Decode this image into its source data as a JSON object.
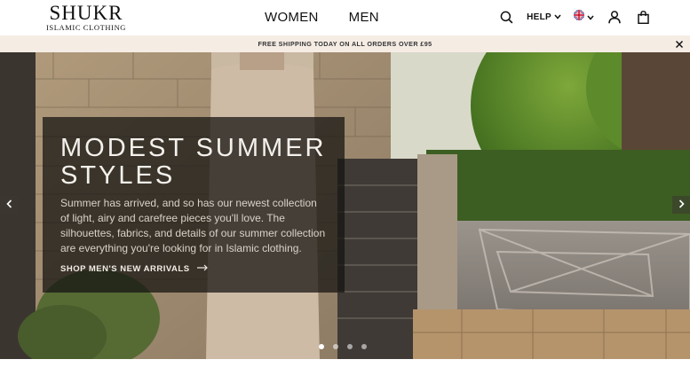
{
  "brand": {
    "name": "SHUKR",
    "tagline": "ISLAMIC CLOTHING"
  },
  "nav": {
    "women": "WOMEN",
    "men": "MEN"
  },
  "header_actions": {
    "help_label": "HELP",
    "icons": [
      "search-icon",
      "chevron-down-icon",
      "uk-flag-icon",
      "user-icon",
      "shopping-bag-icon"
    ]
  },
  "promo": {
    "text": "FREE SHIPPING TODAY ON ALL ORDERS OVER £95",
    "background": "#f5ece4"
  },
  "hero": {
    "title": "MODEST SUMMER STYLES",
    "body": "Summer has arrived, and so has our newest collection of light, airy and carefree pieces you'll love. The silhouettes, fabrics, and details of our summer collection are everything you're looking for in Islamic clothing.",
    "cta": "SHOP MEN'S NEW ARRIVALS",
    "slide_count": 4,
    "active_slide": 1
  }
}
